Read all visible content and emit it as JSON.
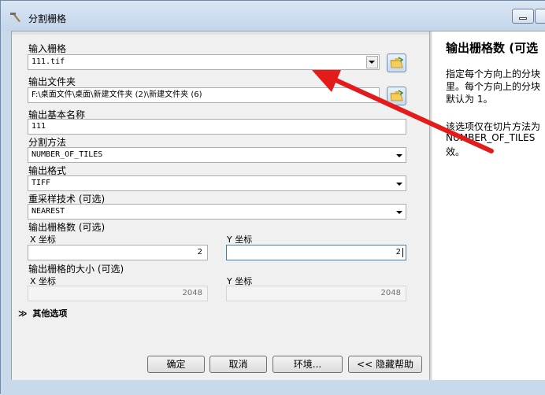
{
  "window": {
    "title": "分割栅格"
  },
  "form": {
    "input_raster": {
      "label": "输入栅格",
      "value": "111.tif"
    },
    "output_folder": {
      "label": "输出文件夹",
      "value": "F:\\桌面文件\\桌面\\新建文件夹 (2)\\新建文件夹 (6)"
    },
    "output_base_name": {
      "label": "输出基本名称",
      "value": "111"
    },
    "split_method": {
      "label": "分割方法",
      "value": "NUMBER_OF_TILES"
    },
    "output_format": {
      "label": "输出格式",
      "value": "TIFF"
    },
    "resampling": {
      "label": "重采样技术 (可选)",
      "value": "NEAREST"
    },
    "num_rasters": {
      "label": "输出栅格数 (可选)",
      "x_label": "X 坐标",
      "x_value": "2",
      "y_label": "Y 坐标",
      "y_value": "2"
    },
    "tile_size": {
      "label": "输出栅格的大小 (可选)",
      "x_label": "X 坐标",
      "x_value": "2048",
      "y_label": "Y 坐标",
      "y_value": "2048"
    },
    "other_options": {
      "toggle": "≫",
      "label": "其他选项"
    }
  },
  "buttons": {
    "ok": "确定",
    "cancel": "取消",
    "env": "环境...",
    "hide_help": "<< 隐藏帮助"
  },
  "help": {
    "title": "输出栅格数 (可选",
    "line1": "指定每个方向上的分块",
    "line2": "里。每个方向上的分块",
    "line3": "默认为 1。",
    "line4": "该选项仅在切片方法为",
    "line5": "NUMBER_OF_TILES",
    "line6": "效。"
  },
  "colors": {
    "annotation_arrow": "#e31b1b"
  }
}
